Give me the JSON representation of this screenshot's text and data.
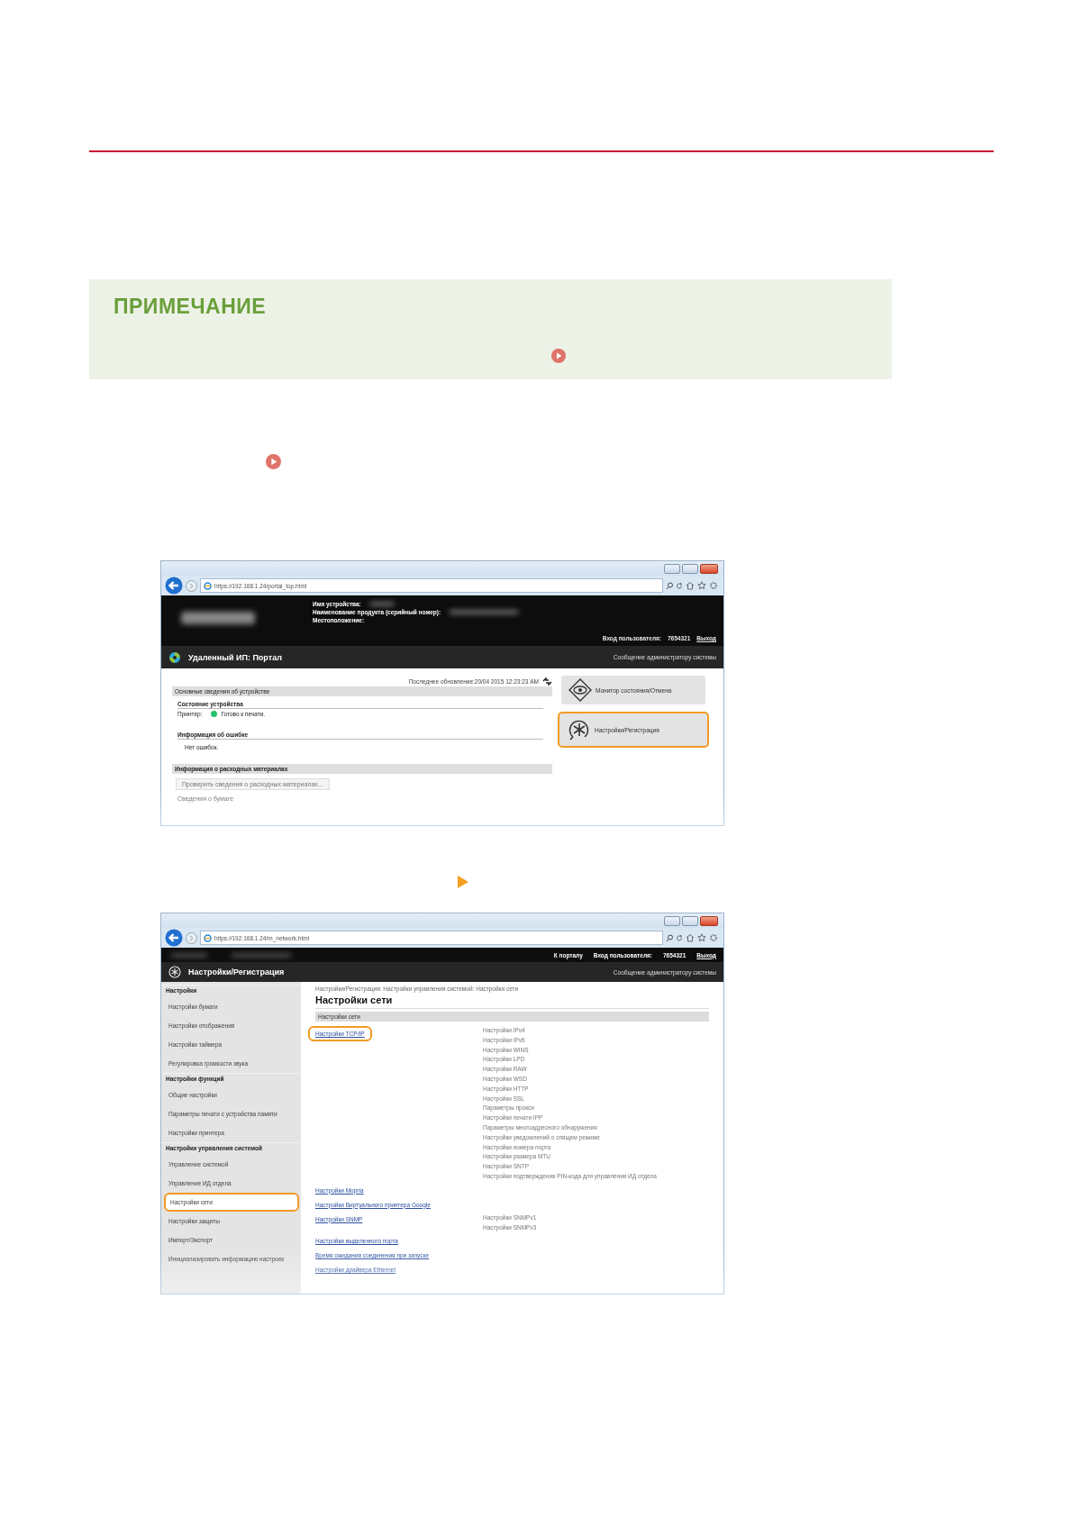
{
  "note": {
    "title": "ПРИМЕЧАНИЕ"
  },
  "portal_screenshot": {
    "url": "https://192.168.1.24/portal_top.html",
    "device_labels": [
      "Имя устройства:",
      "Наименование продукта (серийный номер):",
      "Местоположение:"
    ],
    "login_label": "Вход пользователя:",
    "user_id": "7654321",
    "logout": "Выход",
    "title": "Удаленный ИП: Портал",
    "admin_message": "Сообщение администратору системы",
    "last_update": "Последнее обновление:20/04 2015 12:23:23 AM",
    "device_section": {
      "title": "Основные сведения об устройстве",
      "status_heading": "Состояние устройства",
      "printer_label": "Принтер:",
      "printer_status": "Готово к печати.",
      "error_heading": "Информация об ошибке",
      "error_text": "Нет ошибок."
    },
    "consumables_section": {
      "title": "Информация о расходных материалах",
      "button": "Проверить сведения о расходных материалах...",
      "next_item": "Сведения о бумаге"
    },
    "menu_buttons": [
      {
        "kind": "monitor",
        "label": "Монитор состояния/Отмена",
        "selected": false
      },
      {
        "kind": "settings",
        "label": "Настройки/Регистрация",
        "selected": true
      }
    ]
  },
  "network_screenshot": {
    "url": "https://192.168.1.24/m_network.html",
    "portal_link": "К порталу",
    "login_label": "Вход пользователя:",
    "user_id": "7654321",
    "logout": "Выход",
    "title": "Настройки/Регистрация",
    "admin_message": "Сообщение администратору системы",
    "sidebar": [
      {
        "heading": "Настройки",
        "items": [
          {
            "label": "Настройки бумаги",
            "selected": false
          },
          {
            "label": "Настройки отображения",
            "selected": false
          },
          {
            "label": "Настройки таймера",
            "selected": false
          },
          {
            "label": "Регулировка громкости звука",
            "selected": false
          }
        ]
      },
      {
        "heading": "Настройки функций",
        "items": [
          {
            "label": "Общие настройки",
            "selected": false
          },
          {
            "label": "Параметры печати с устройства памяти",
            "selected": false
          },
          {
            "label": "Настройки принтера",
            "selected": false
          }
        ]
      },
      {
        "heading": "Настройки управления системой",
        "items": [
          {
            "label": "Управление системой",
            "selected": false
          },
          {
            "label": "Управление ИД отдела",
            "selected": false
          },
          {
            "label": "Настройки сети",
            "selected": true
          },
          {
            "label": "Настройки защиты",
            "selected": false
          },
          {
            "label": "Импорт/Экспорт",
            "selected": false
          },
          {
            "label": "Инициализировать информацию настроек",
            "selected": false
          }
        ]
      }
    ],
    "breadcrumb": "Настройки/Регистрация: Настройки управления системой: Настройки сети",
    "heading": "Настройки сети",
    "section_title": "Настройки сети",
    "rows": [
      {
        "link": "Настройки TCP/IP",
        "highlighted": true,
        "subitems": [
          "Настройки IPv4",
          "Настройки IPv6",
          "Настройки WINS",
          "Настройки LPD",
          "Настройки RAW",
          "Настройки WSD",
          "Настройки HTTP",
          "Настройки SSL",
          "Параметры прокси",
          "Настройки печати IPP",
          "Параметры многоадресного обнаружения",
          "Настройки уведомлений о спящем режиме",
          "Настройки номера порта",
          "Настройки размера MTU",
          "Настройки SNTP",
          "Настройки подтверждения PIN-кода для управления ИД отдела"
        ]
      },
      {
        "link": "Настройки Mopria",
        "highlighted": false
      },
      {
        "link": "Настройки Виртуального принтера Google",
        "highlighted": false
      },
      {
        "link": "Настройки SNMP",
        "highlighted": false,
        "subitems": [
          "Настройки SNMPv1",
          "Настройки SNMPv3"
        ]
      },
      {
        "link": "Настройки выделенного порта",
        "highlighted": false
      },
      {
        "link": "Время ожидания соединения при запуске",
        "highlighted": false
      },
      {
        "link": "Настройки драйвера Ethernet",
        "highlighted": false
      }
    ]
  }
}
